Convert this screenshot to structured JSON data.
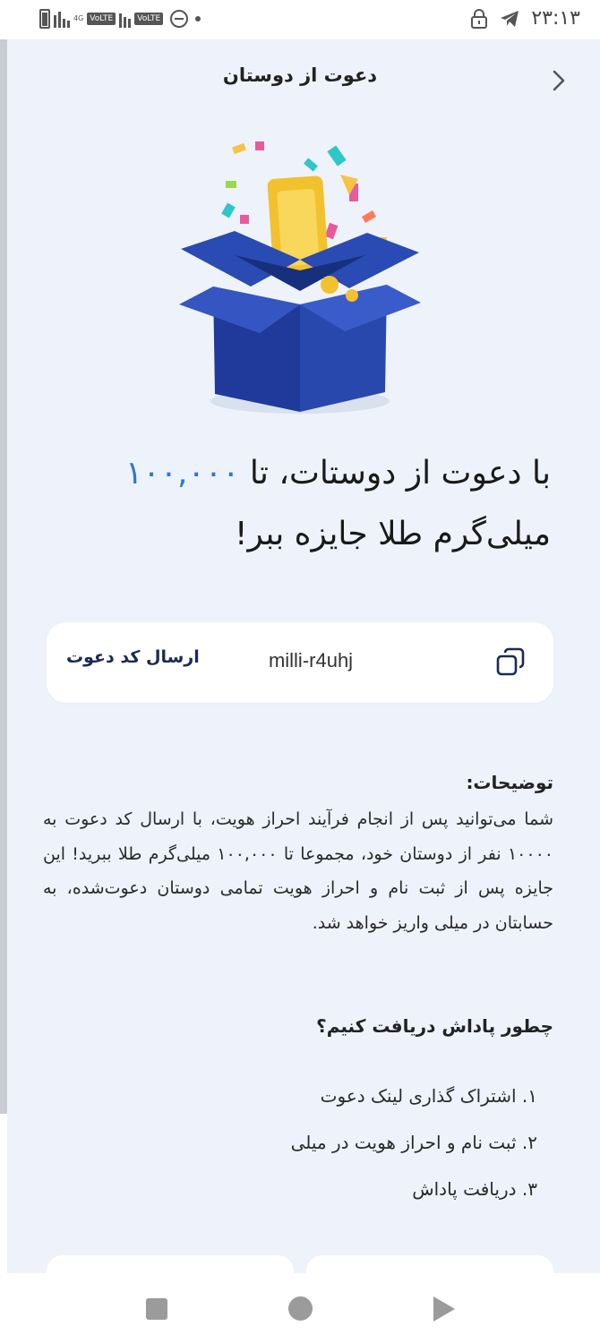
{
  "status_bar": {
    "time": "۲۳:۱۳",
    "network_4g": "4G",
    "volte_1": "VoLTE",
    "volte_2": "VoLTE",
    "icons": [
      "battery-icon",
      "signal-icon",
      "volte-icon",
      "do-not-disturb-icon",
      "notification-dot-icon",
      "lock-icon",
      "telegram-icon"
    ]
  },
  "header": {
    "title": "دعوت از دوستان",
    "back_icon": "chevron-left-icon"
  },
  "hero": {
    "image": "gift-box-with-gold-bar-illustration"
  },
  "headline": {
    "part1": "با دعوت از دوستات، تا ",
    "amount": "۱۰۰,۰۰۰",
    "part2": " میلی‌گرم طلا جایزه ببر!"
  },
  "invite_card": {
    "send_label": "ارسال کد دعوت",
    "code": "milli-r4uhj",
    "copy_icon": "copy-icon"
  },
  "description": {
    "title": "توضیحات:",
    "body": "شما می‌توانید پس از انجام فرآیند احراز هویت، با ارسال کد دعوت به ۱۰۰۰۰ نفر از دوستان خود، مجموعا تا ۱۰۰,۰۰۰ میلی‌گرم طلا ببرید! این جایزه پس از ثبت نام و احراز هویت تمامی دوستان دعوت‌شده، به حسابتان در میلی واریز خواهد شد."
  },
  "how_to": {
    "title": "چطور پاداش دریافت کنیم؟",
    "steps": [
      "۱. اشتراک گذاری لینک دعوت",
      "۲. ثبت نام و احراز هویت در میلی",
      "۳. دریافت پاداش"
    ]
  },
  "nav_bar": {
    "icons": [
      "recent-apps-icon",
      "home-icon",
      "back-icon"
    ]
  },
  "colors": {
    "accent": "#2b77d8",
    "panel_bg": "#eef3fb",
    "box_blue": "#1f3a9a",
    "gold": "#f2c12e"
  }
}
